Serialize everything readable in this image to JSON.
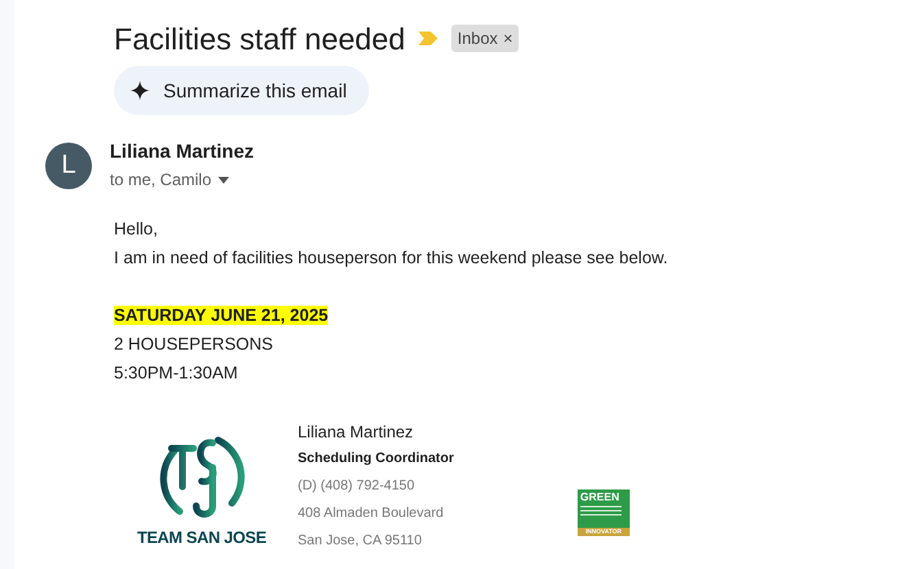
{
  "subject": "Facilities staff needed",
  "important": true,
  "labels": [
    {
      "text": "Inbox",
      "close": "×"
    }
  ],
  "summarize_button": {
    "label": "Summarize this email"
  },
  "sender": {
    "avatar": "L",
    "name": "Liliana Martinez",
    "recipients": "to me, Camilo"
  },
  "body": {
    "greeting": "Hello,",
    "lines": [
      "I am in need of facilities houseperson for this weekend please see below."
    ],
    "details": [
      {
        "text": "SATURDAY JUNE 21, 2025",
        "highlighted": true
      },
      {
        "text": "2 HOUSEPERSONS",
        "highlighted": false
      },
      {
        "text": "5:30PM-1:30AM",
        "highlighted": false
      }
    ]
  },
  "signature": {
    "logo_text": "TEAM SAN JOSE",
    "name": "Liliana Martinez",
    "title": "Scheduling Coordinator",
    "lines": [
      "(D) (408) 792-4150",
      "408 Almaden Boulevard",
      "San Jose, CA 95110"
    ],
    "badge": {
      "top": "GREEN",
      "bottom": "INNOVATOR"
    }
  }
}
